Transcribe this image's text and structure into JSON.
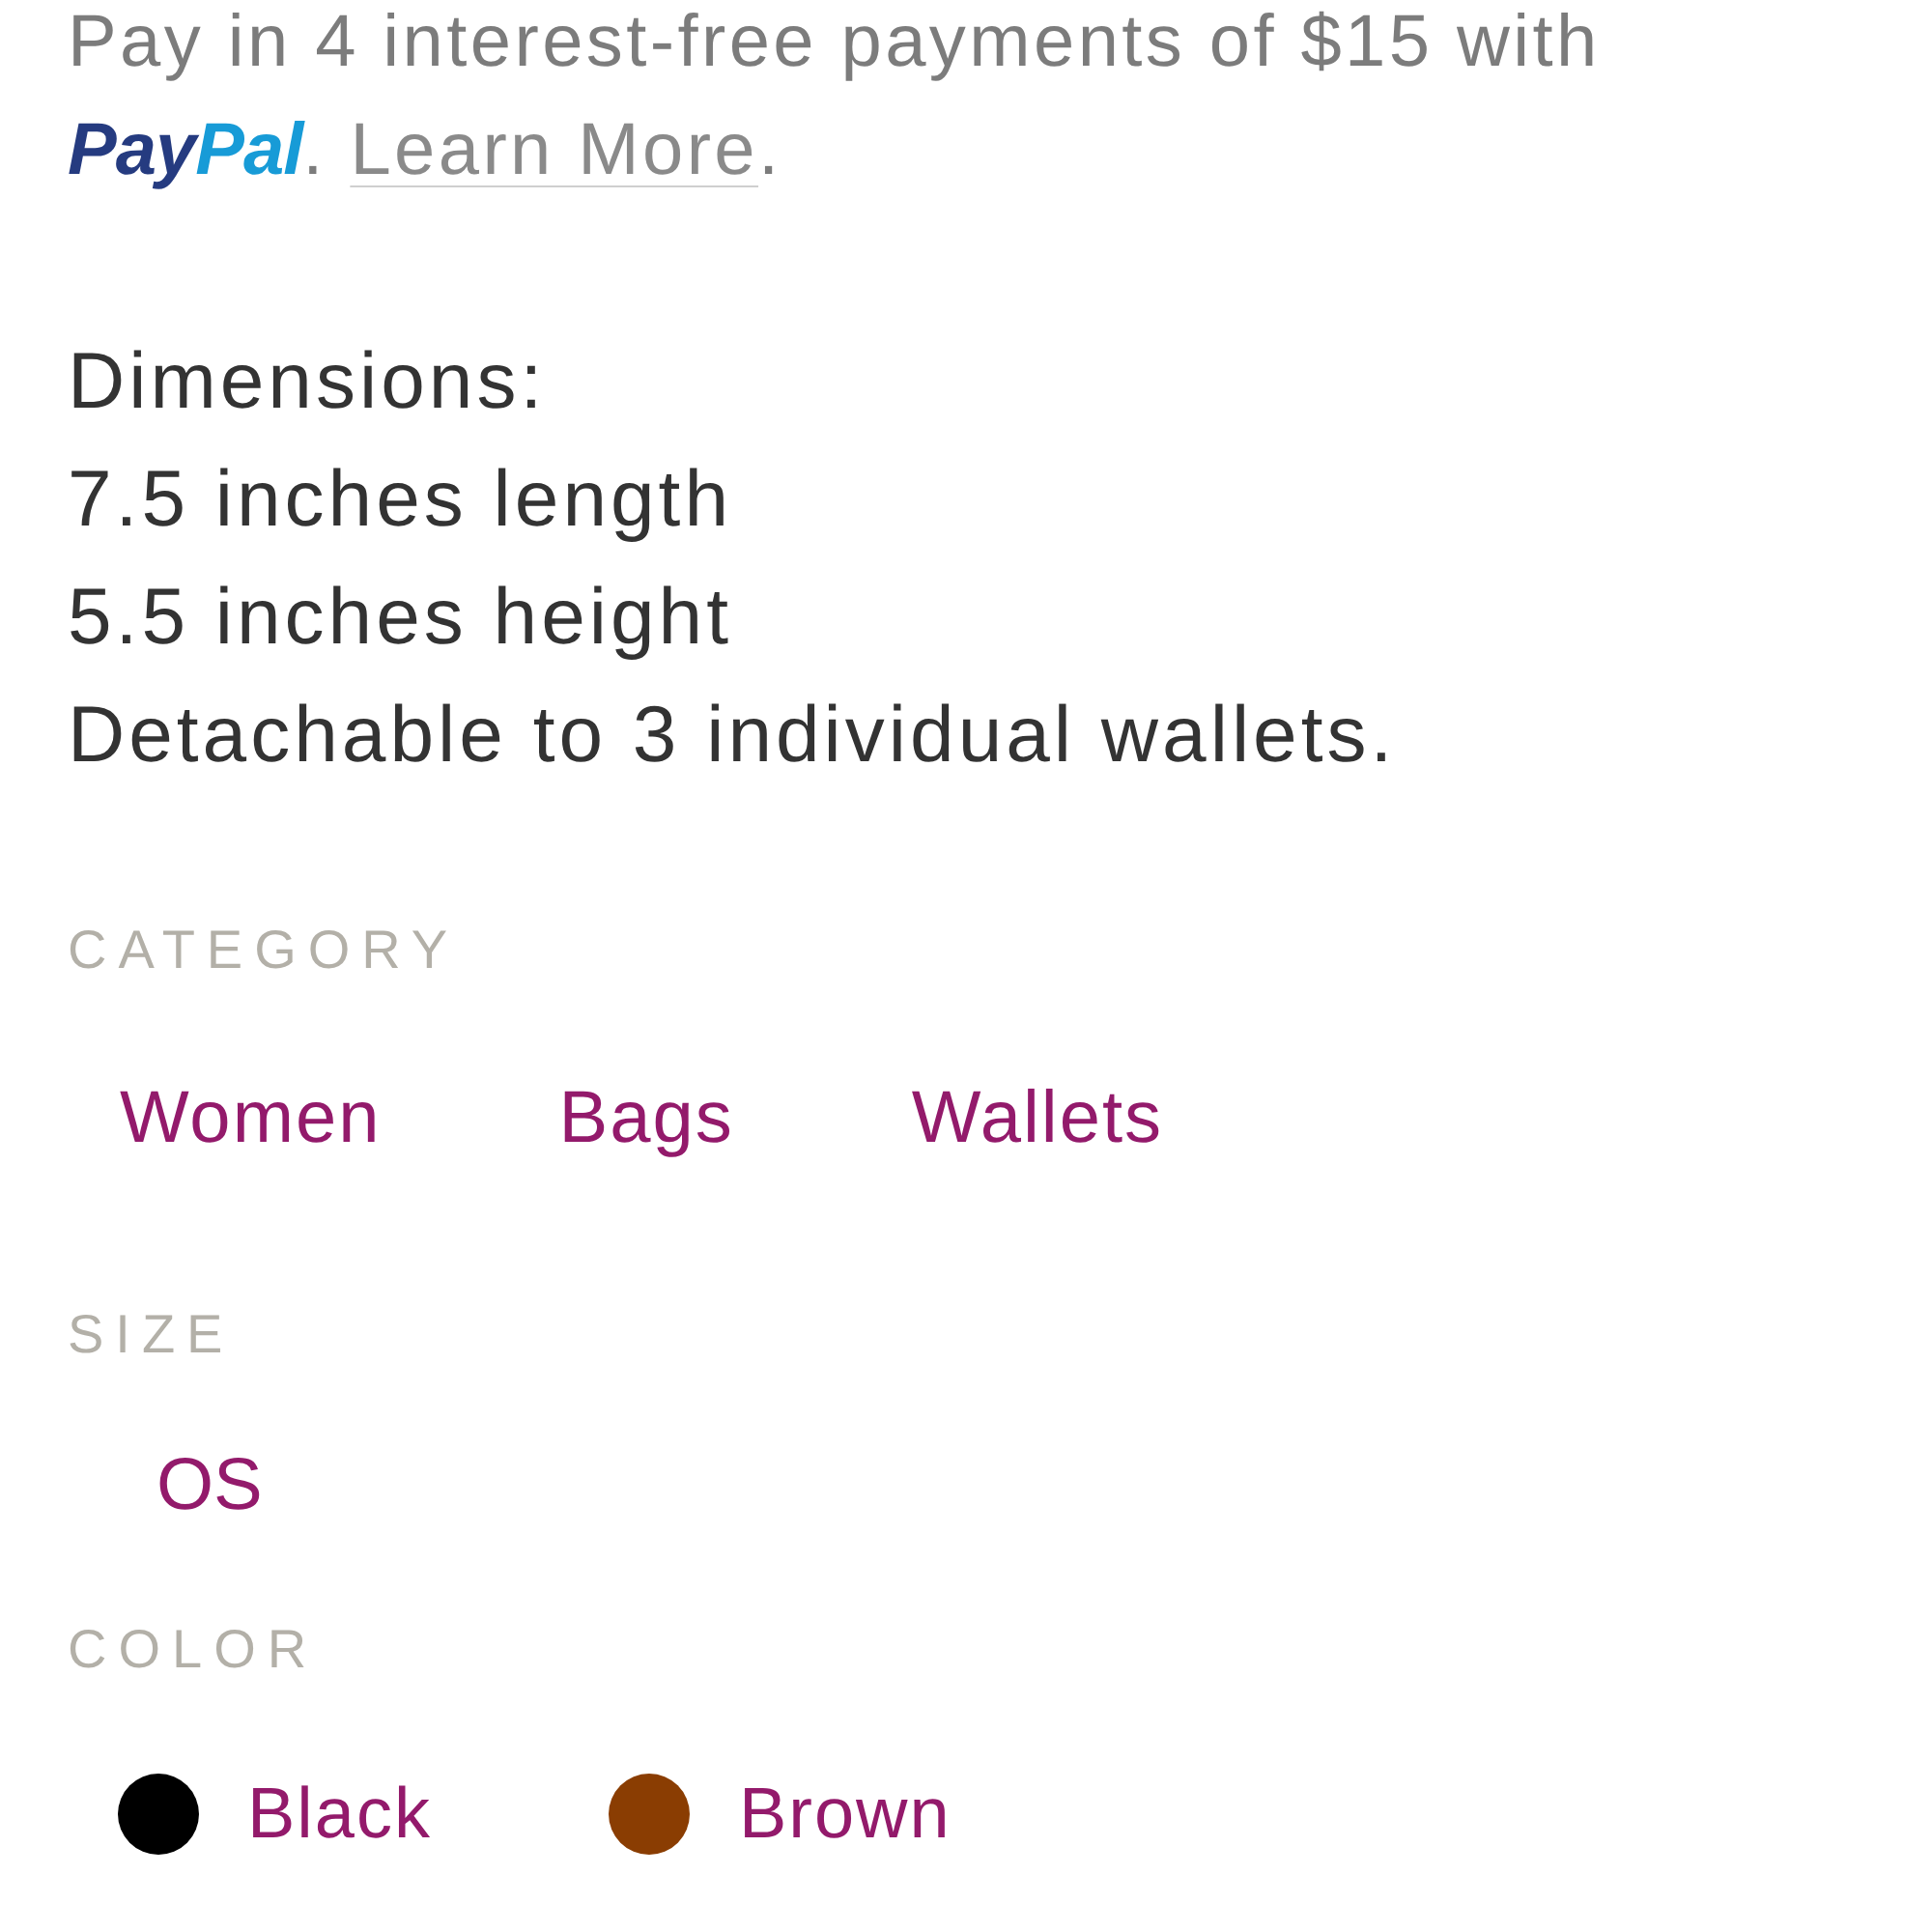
{
  "payment_note": {
    "text": "Pay in 4 interest-free payments of $15 with",
    "logo": {
      "first": "Pay",
      "second": "Pal"
    },
    "after_logo": ".",
    "link": "Learn More",
    "end": "."
  },
  "description": {
    "lines": [
      "Dimensions:",
      "7.5 inches length",
      "5.5 inches height",
      "Detachable to 3 individual wallets."
    ]
  },
  "category": {
    "label": "CATEGORY",
    "links": [
      "Women",
      "Bags",
      "Wallets"
    ]
  },
  "size": {
    "label": "SIZE",
    "options": [
      "OS"
    ]
  },
  "color": {
    "label": "COLOR",
    "options": [
      {
        "name": "Black",
        "color": "#000000"
      },
      {
        "name": "Brown",
        "color": "#8a3d02"
      }
    ]
  }
}
